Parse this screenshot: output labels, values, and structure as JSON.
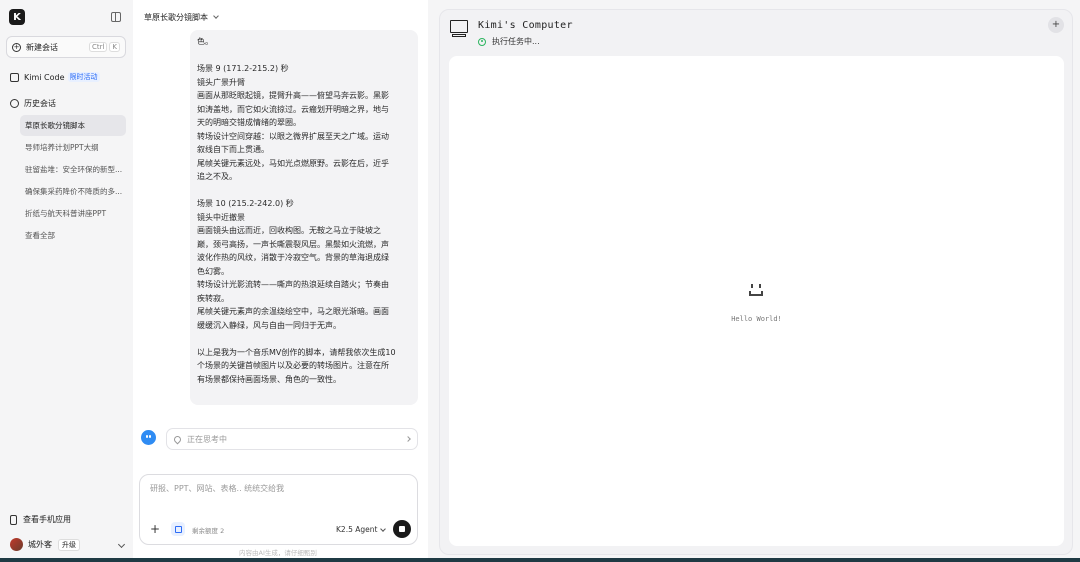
{
  "sidebar": {
    "logo": "K",
    "new_chat": {
      "label": "新建会话",
      "shortcut_ctrl": "Ctrl",
      "shortcut_key": "K"
    },
    "kimi_code": {
      "label": "Kimi Code",
      "badge": "限时活动"
    },
    "history_label": "历史会话",
    "history": [
      "草原长歌分镜脚本",
      "导师培养计划PPT大纲",
      "驻留盐堆：安全环保的新型...",
      "确保集采药降价不降质的多...",
      "折纸与航天科普讲座PPT",
      "查看全部"
    ],
    "mobile_app": "查看手机应用",
    "user": {
      "name": "城外客",
      "upgrade": "升级"
    }
  },
  "chat": {
    "title": "草原长歌分镜脚本",
    "message_lines": [
      "色。",
      "",
      "场景 9 (171.2-215.2) 秒",
      "镜头广景升臂",
      "画面从那眨眼起镜，提臂升高——俯望马奔云影。黑影",
      "如涛盖地，而它如火流掠过。云瘢划开明暗之界，地与",
      "天的明暗交错成情绪的翠圈。",
      "转场设计空间穿越：以眼之微界扩展至天之广域。运动",
      "叙线自下而上贯通。",
      "尾帧关键元素远处，马如光点燃原野。云影在后，近乎",
      "追之不及。",
      "",
      "场景 10 (215.2-242.0) 秒",
      "镜头中近撤景",
      "画面镜头由远而近，回收构图。无鞍之马立于陡坡之",
      "巅，颈弓高扬，一声长嘶震裂风层。黑鬃如火流燃，声",
      "波化作热的风纹，消散于冷寂空气。背景的草海退成绿",
      "色幻雾。",
      "转场设计光影流转——嘶声的热浪延续自踏火；节奏由",
      "疾转寂。",
      "尾帧关键元素声的余温绕绘空中，马之眼光渐暗。画面",
      "缓缓沉入静绿，风与自由一同归于无声。",
      "",
      "以上是我为一个音乐MV创作的脚本，请帮我依次生成10",
      "个场景的关键首帧图片以及必要的转场图片。注意在所",
      "有场景都保持画面场景、角色的一致性。"
    ],
    "thinking": "正在思考中",
    "composer": {
      "placeholder": "研报、PPT、网站、表格.. 统统交给我",
      "remaining": "剩余额度 2",
      "model": "K2.5 Agent"
    },
    "disclaimer": "内容由AI生成，请仔细甄别"
  },
  "computer": {
    "title": "Kimi's Computer",
    "status": "执行任务中...",
    "status_color": "#2db560",
    "hello": "Hello World!"
  }
}
